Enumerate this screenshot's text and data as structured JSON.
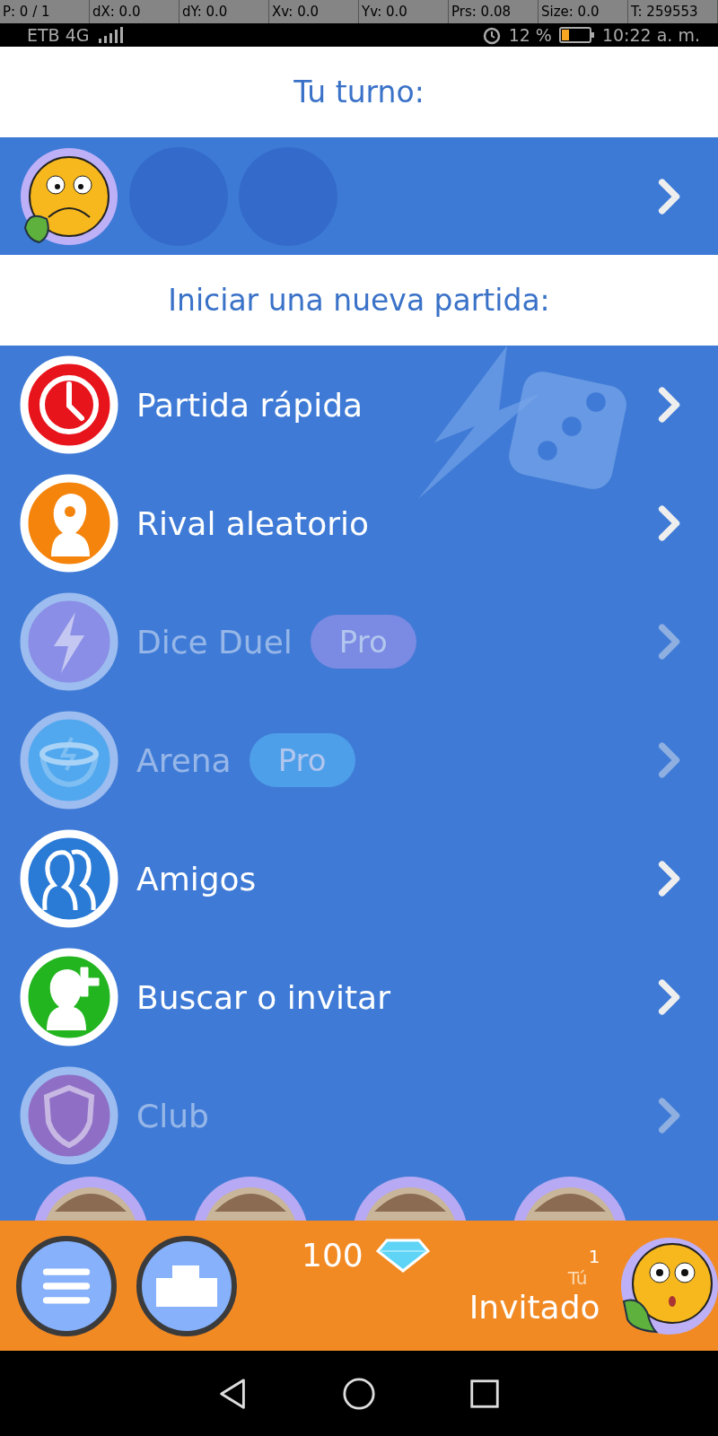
{
  "debug_overlay": [
    "P: 0 / 1",
    "dX: 0.0",
    "dY: 0.0",
    "Xv: 0.0",
    "Yv: 0.0",
    "Prs: 0.08",
    "Size: 0.0",
    "T: 259553"
  ],
  "status_bar": {
    "carrier": "ETB 4G",
    "battery": "12 %",
    "time": "10:22 a. m."
  },
  "turn_header": "Tu turno:",
  "turn_slots": [
    {
      "kind": "player"
    },
    {
      "kind": "empty"
    },
    {
      "kind": "empty"
    }
  ],
  "new_game_header": "Iniciar una nueva partida:",
  "menu": [
    {
      "label": "Partida rápida",
      "kind": "clock",
      "color": "#e8141c",
      "disabled": false
    },
    {
      "label": "Rival aleatorio",
      "kind": "mystery",
      "color": "#f5840c",
      "disabled": false
    },
    {
      "label": "Dice Duel",
      "kind": "lightning",
      "color": "#8a8ee6",
      "disabled": true,
      "badge": "Pro"
    },
    {
      "label": "Arena",
      "kind": "arena",
      "color": "#52a8ee",
      "disabled": true,
      "badge": "Pro"
    },
    {
      "label": "Amigos",
      "kind": "friends",
      "color": "#2a7bd6",
      "disabled": false
    },
    {
      "label": "Buscar o invitar",
      "kind": "invite",
      "color": "#22b51f",
      "disabled": false
    },
    {
      "label": "Club",
      "kind": "shield",
      "color": "#8f6fc6",
      "disabled": true
    }
  ],
  "bottom_bar": {
    "gems": "100",
    "rank": "1",
    "you_label": "Tú",
    "player_name": "Invitado"
  }
}
